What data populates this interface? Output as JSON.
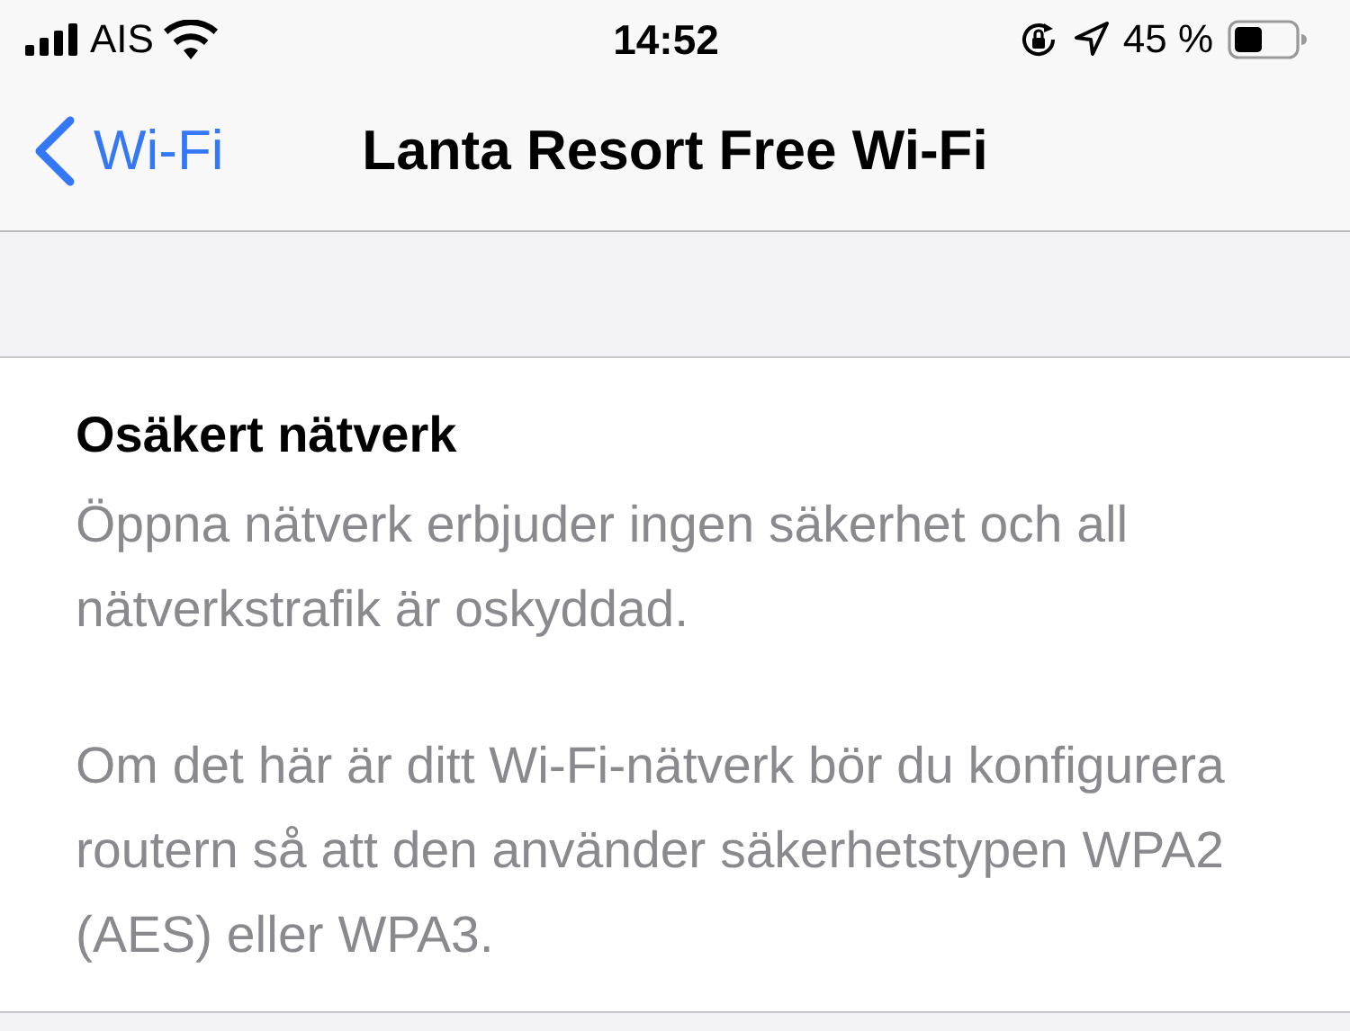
{
  "status_bar": {
    "carrier": "AIS",
    "time": "14:52",
    "battery_percent": "45 %"
  },
  "nav_bar": {
    "back_label": "Wi-Fi",
    "title": "Lanta Resort Free Wi-Fi"
  },
  "info": {
    "heading": "Osäkert nätverk",
    "paragraphs": [
      "Öppna nätverk erbjuder ingen säkerhet och all nätverkstrafik är oskyddad.",
      "Om det här är ditt Wi-Fi-nätverk bör du konfigurera routern så att den använder säkerhetstypen WPA2 (AES) eller WPA3."
    ]
  }
}
